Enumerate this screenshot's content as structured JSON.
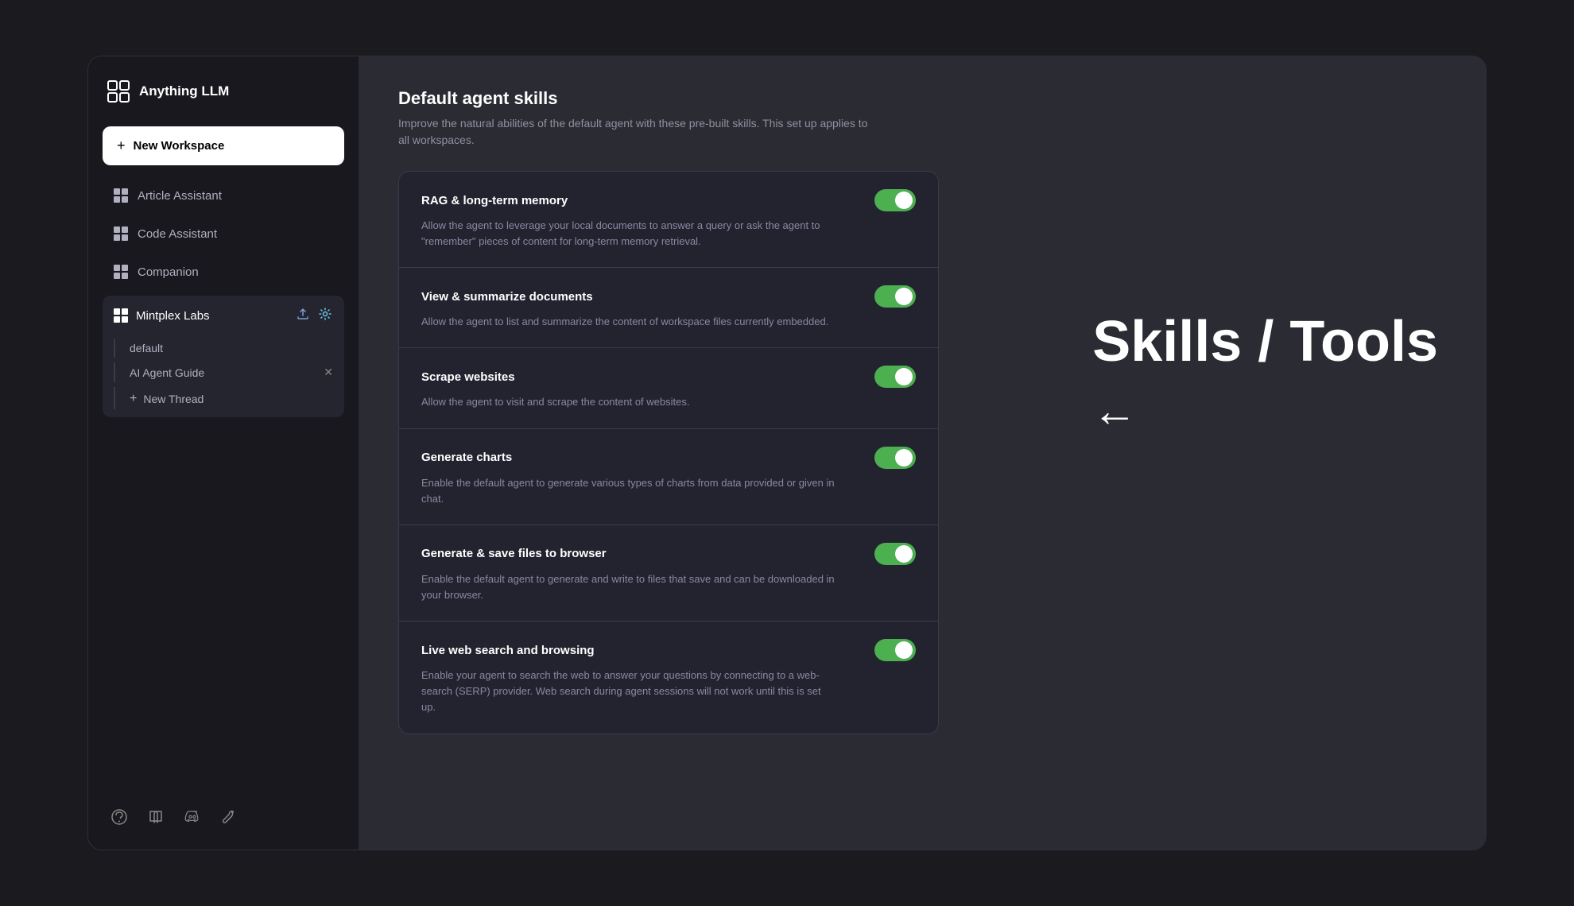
{
  "app": {
    "title": "Anything LLM",
    "logo_symbol": "⊠"
  },
  "sidebar": {
    "new_workspace_label": "New Workspace",
    "workspaces": [
      {
        "name": "Article Assistant",
        "active": false
      },
      {
        "name": "Code Assistant",
        "active": false
      },
      {
        "name": "Companion",
        "active": false
      }
    ],
    "active_workspace": {
      "name": "Mintplex Labs",
      "sub_thread": "default",
      "thread_label": "AI Agent Guide",
      "new_thread_label": "New Thread"
    },
    "footer_icons": [
      "hand-icon",
      "book-icon",
      "discord-icon",
      "wrench-icon"
    ]
  },
  "main": {
    "page_title": "Default agent skills",
    "page_subtitle": "Improve the natural abilities of the default agent with these pre-built skills. This set up applies to all workspaces.",
    "skills": [
      {
        "name": "RAG & long-term memory",
        "description": "Allow the agent to leverage your local documents to answer a query or ask the agent to \"remember\" pieces of content for long-term memory retrieval.",
        "enabled": true
      },
      {
        "name": "View & summarize documents",
        "description": "Allow the agent to list and summarize the content of workspace files currently embedded.",
        "enabled": true
      },
      {
        "name": "Scrape websites",
        "description": "Allow the agent to visit and scrape the content of websites.",
        "enabled": true
      },
      {
        "name": "Generate charts",
        "description": "Enable the default agent to generate various types of charts from data provided or given in chat.",
        "enabled": true
      },
      {
        "name": "Generate & save files to browser",
        "description": "Enable the default agent to generate and write to files that save and can be downloaded in your browser.",
        "enabled": true
      },
      {
        "name": "Live web search and browsing",
        "description": "Enable your agent to search the web to answer your questions by connecting to a web-search (SERP) provider.\nWeb search during agent sessions will not work until this is set up.",
        "enabled": true
      }
    ]
  },
  "annotation": {
    "line1": "Skills / Tools",
    "arrow": "←"
  }
}
